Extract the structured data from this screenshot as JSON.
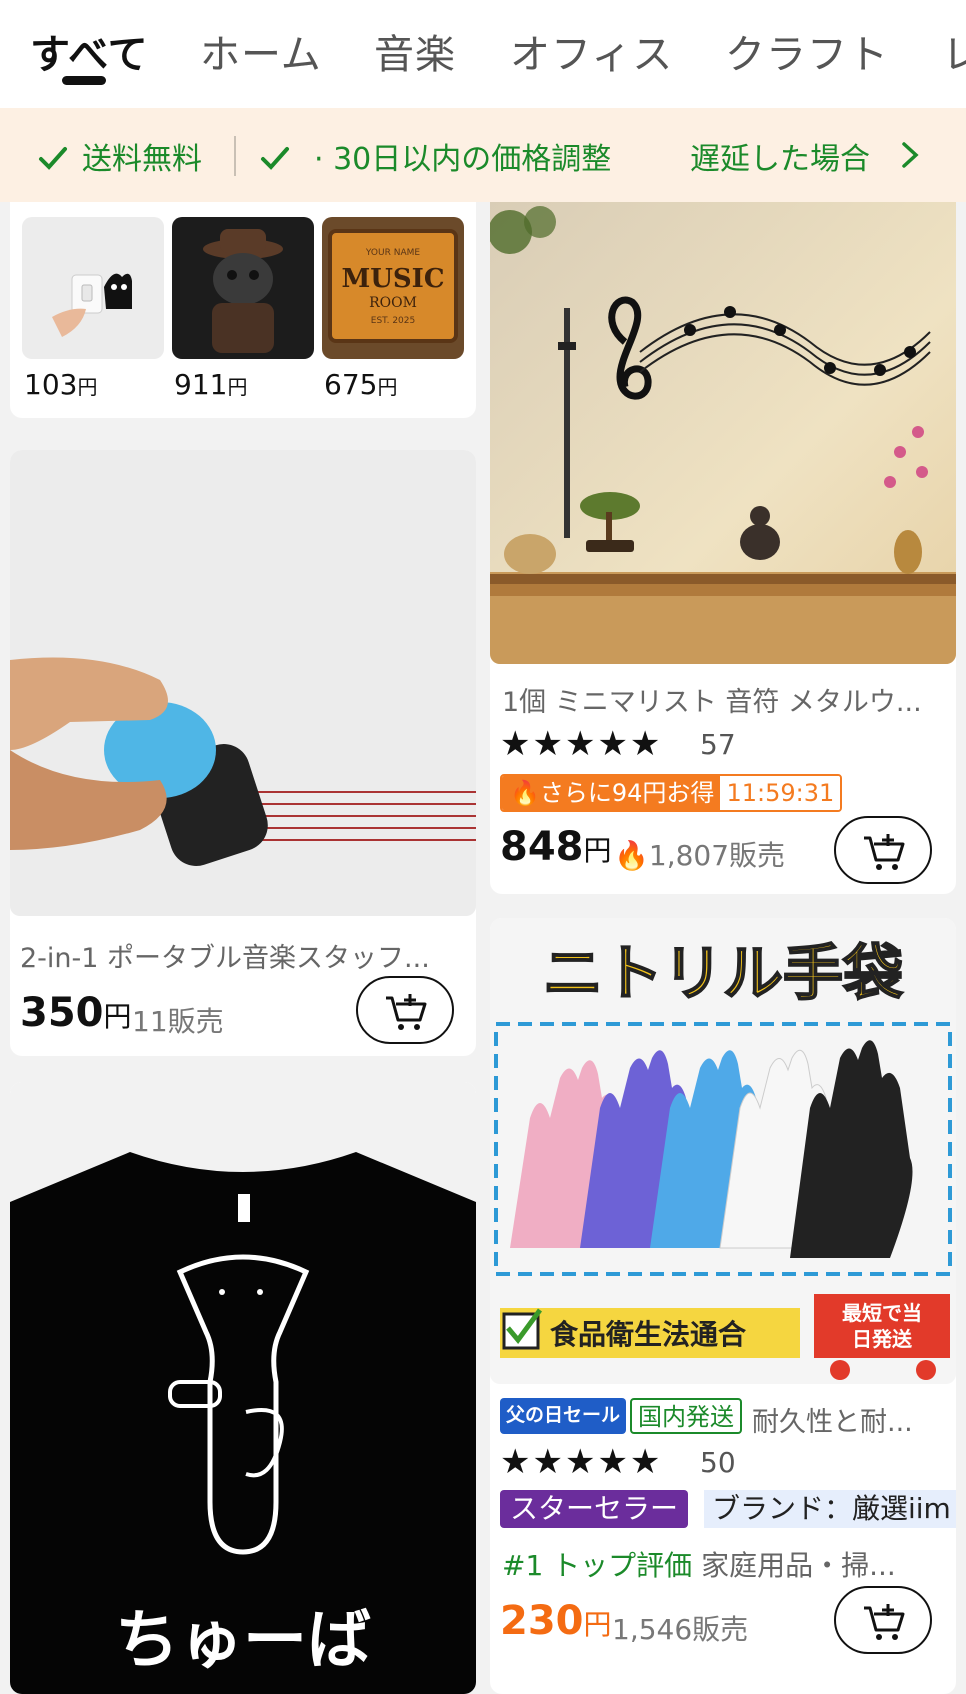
{
  "tabs": [
    "すべて",
    "ホーム",
    "音楽",
    "オフィス",
    "クラフト",
    "レ"
  ],
  "promo": {
    "item1": "送料無料",
    "item2": "· 30日以内の価格調整",
    "item3": "遅延した場合"
  },
  "thumbs": [
    {
      "price": "103",
      "yen": "円"
    },
    {
      "price": "911",
      "yen": "円"
    },
    {
      "price": "675",
      "yen": "円"
    }
  ],
  "thumb_sign": {
    "line1": "YOUR NAME",
    "line2": "MUSIC",
    "line3": "ROOM",
    "line4": "EST. 2025"
  },
  "products": {
    "staff_pen": {
      "title": "2-in-1 ポータブル音楽スタッフ...",
      "price": "350",
      "yen": "円",
      "sold": "11販売"
    },
    "music_wall": {
      "title": "1個 ミニマリスト 音符 メタルウ...",
      "stars": "★★★★★",
      "rating_count": "57",
      "deal_text": "さらに94円お得",
      "deal_timer": "11:59:31",
      "price": "848",
      "yen": "円",
      "sold": "1,807販売"
    },
    "gloves": {
      "image_headline": "ニトリル手袋",
      "image_caption": "食品衛生法通合",
      "image_ship_line1": "最短で当",
      "image_ship_line2": "日発送",
      "badge_sale": "父の日セール",
      "badge_domestic": "国内発送",
      "title": "耐久性と耐...",
      "stars": "★★★★★",
      "rating_count": "50",
      "badge_star_seller": "スターセラー",
      "badge_brand": "ブランド：厳選iim",
      "top_rated": "#1 トップ評価",
      "category": "家庭用品・掃...",
      "price": "230",
      "yen": "円",
      "sold": "1,546販売"
    },
    "tshirt": {
      "print_text": "ちゅーば"
    }
  },
  "colors": {
    "accent_green": "#1b8a2a",
    "accent_orange": "#f46b12",
    "promo_bg": "#fdf0e3"
  }
}
